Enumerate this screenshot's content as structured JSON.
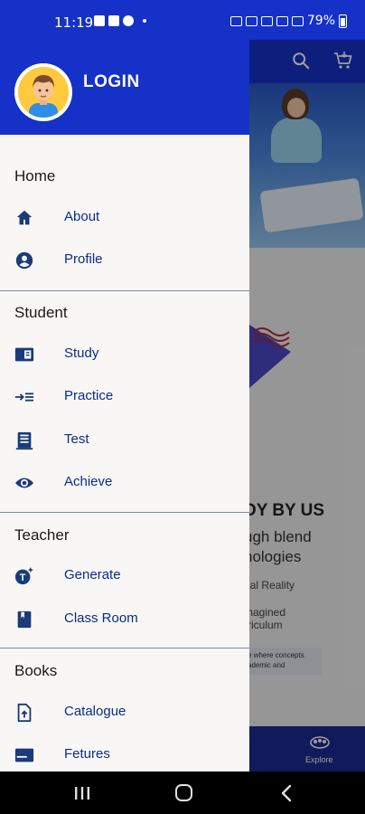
{
  "status_bar": {
    "time": "11:19",
    "battery": "79%"
  },
  "background_app": {
    "heading": "DY BY US",
    "line1": "ugh blend",
    "line2": "nologies",
    "item1": "ual Reality",
    "item2": "magined",
    "item3": "rriculum",
    "note": "e where concepts ademic and",
    "explore_label": "Explore",
    "colors": {
      "toolbar": "#1531c8",
      "bottom_nav": "#1a2a95"
    }
  },
  "drawer": {
    "login_label": "LOGIN",
    "avatar_icon": "user-avatar-icon",
    "sections": {
      "home": {
        "title": "Home",
        "items": [
          {
            "label": "About",
            "icon": "home-icon"
          },
          {
            "label": "Profile",
            "icon": "account-circle-icon"
          }
        ]
      },
      "student": {
        "title": "Student",
        "items": [
          {
            "label": "Study",
            "icon": "study-book-icon"
          },
          {
            "label": "Practice",
            "icon": "practice-list-icon"
          },
          {
            "label": "Test",
            "icon": "test-notebook-icon"
          },
          {
            "label": "Achieve",
            "icon": "eye-icon"
          }
        ]
      },
      "teacher": {
        "title": "Teacher",
        "items": [
          {
            "label": "Generate",
            "icon": "generate-ai-icon"
          },
          {
            "label": "Class Room",
            "icon": "classroom-book-icon"
          }
        ]
      },
      "books": {
        "title": "Books",
        "items": [
          {
            "label": "Catalogue",
            "icon": "file-upload-icon"
          },
          {
            "label": "Fetures",
            "icon": "features-card-icon"
          }
        ]
      }
    },
    "colors": {
      "header": "#1531c8",
      "item_text": "#0d2b8a",
      "icon": "#1a3a7a"
    }
  }
}
